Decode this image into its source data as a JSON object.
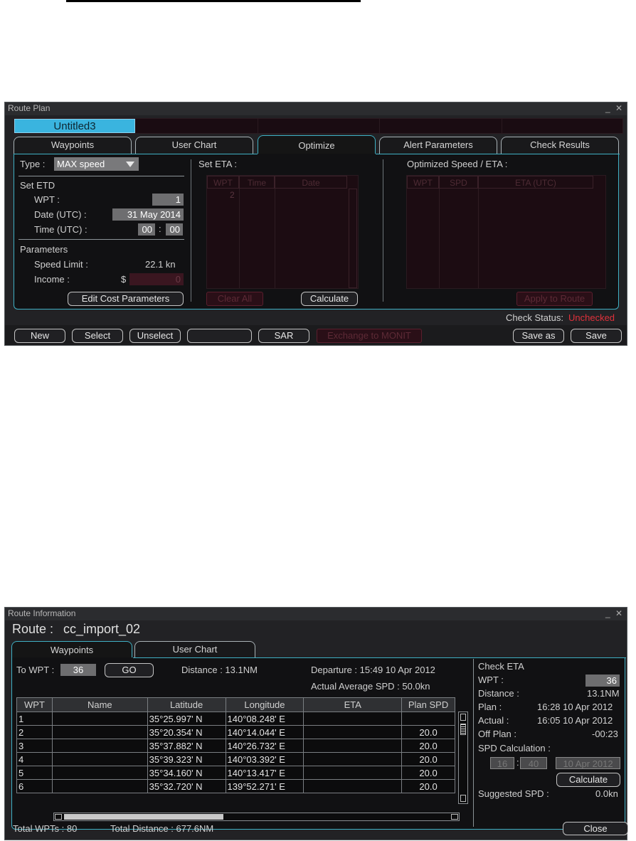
{
  "route_plan": {
    "title": "Route Plan",
    "window_controls": "_ ✕",
    "route_tab_active": "Untitled3",
    "tabs": [
      "Waypoints",
      "User Chart",
      "Optimize",
      "Alert Parameters",
      "Check Results"
    ],
    "type_label": "Type :",
    "type_value": "MAX speed",
    "set_etd": {
      "heading": "Set ETD",
      "wpt_label": "WPT :",
      "wpt_value": "1",
      "date_label": "Date (UTC) :",
      "date_value": "31 May 2014",
      "time_label": "Time (UTC) :",
      "time_hh": "00",
      "time_sep": ":",
      "time_mm": "00"
    },
    "parameters": {
      "heading": "Parameters",
      "speed_limit_label": "Speed Limit :",
      "speed_limit_value": "22.1 kn",
      "income_label": "Income :",
      "income_currency": "$",
      "income_value": "0"
    },
    "edit_cost_button": "Edit Cost Parameters",
    "set_eta": {
      "heading": "Set ETA :",
      "columns": [
        "WPT",
        "Time",
        "Date"
      ],
      "first_wpt": "2",
      "clear_all": "Clear All",
      "calculate": "Calculate"
    },
    "optimized": {
      "heading": "Optimized Speed / ETA :",
      "columns": [
        "WPT",
        "SPD",
        "ETA (UTC)"
      ],
      "apply": "Apply to Route"
    },
    "check_status_label": "Check Status:",
    "check_status_value": "Unchecked",
    "check_status_color": "#e0313b",
    "bottom_buttons": {
      "new": "New",
      "select": "Select",
      "unselect": "Unselect",
      "blank": "",
      "sar": "SAR",
      "exchange": "Exchange to MONIT",
      "save_as": "Save as",
      "save": "Save"
    }
  },
  "route_info": {
    "title": "Route Information",
    "window_controls": "_ ✕",
    "route_label": "Route :",
    "route_name": "cc_import_02",
    "tabs": [
      "Waypoints",
      "User Chart"
    ],
    "to_wpt_label": "To WPT :",
    "to_wpt_value": "36",
    "go": "GO",
    "distance": "Distance : 13.1NM",
    "departure": "Departure :  15:49 10 Apr 2012",
    "actual_avg_spd": "Actual Average SPD :  50.0kn",
    "table": {
      "headers": [
        "WPT",
        "Name",
        "Latitude",
        "Longitude",
        "ETA",
        "Plan SPD"
      ],
      "rows": [
        [
          "1",
          "",
          "35°25.997' N",
          "140°08.248' E",
          "",
          ""
        ],
        [
          "2",
          "",
          "35°20.354' N",
          "140°14.044' E",
          "",
          "20.0"
        ],
        [
          "3",
          "",
          "35°37.882' N",
          "140°26.732' E",
          "",
          "20.0"
        ],
        [
          "4",
          "",
          "35°39.323' N",
          "140°03.392' E",
          "",
          "20.0"
        ],
        [
          "5",
          "",
          "35°34.160' N",
          "140°13.417' E",
          "",
          "20.0"
        ],
        [
          "6",
          "",
          "35°32.720' N",
          "139°52.271' E",
          "",
          "20.0"
        ]
      ]
    },
    "check_eta": {
      "heading": "Check ETA",
      "wpt_label": "WPT :",
      "wpt_value": "36",
      "distance_label": "Distance :",
      "distance_value": "13.1NM",
      "plan_label": "Plan :",
      "plan_value": "16:28 10 Apr 2012",
      "actual_label": "Actual :",
      "actual_value": "16:05 10 Apr 2012",
      "off_plan_label": "Off Plan :",
      "off_plan_value": "-00:23",
      "spd_calc_label": "SPD Calculation :",
      "spd_hh": "16",
      "spd_mm": "40",
      "spd_date": "10 Apr 2012",
      "calculate": "Calculate",
      "suggested_label": "Suggested SPD :",
      "suggested_value": "0.0kn"
    },
    "total_wpts": "Total WPTs : 80",
    "total_distance": "Total Distance : 677.6NM",
    "close": "Close"
  }
}
